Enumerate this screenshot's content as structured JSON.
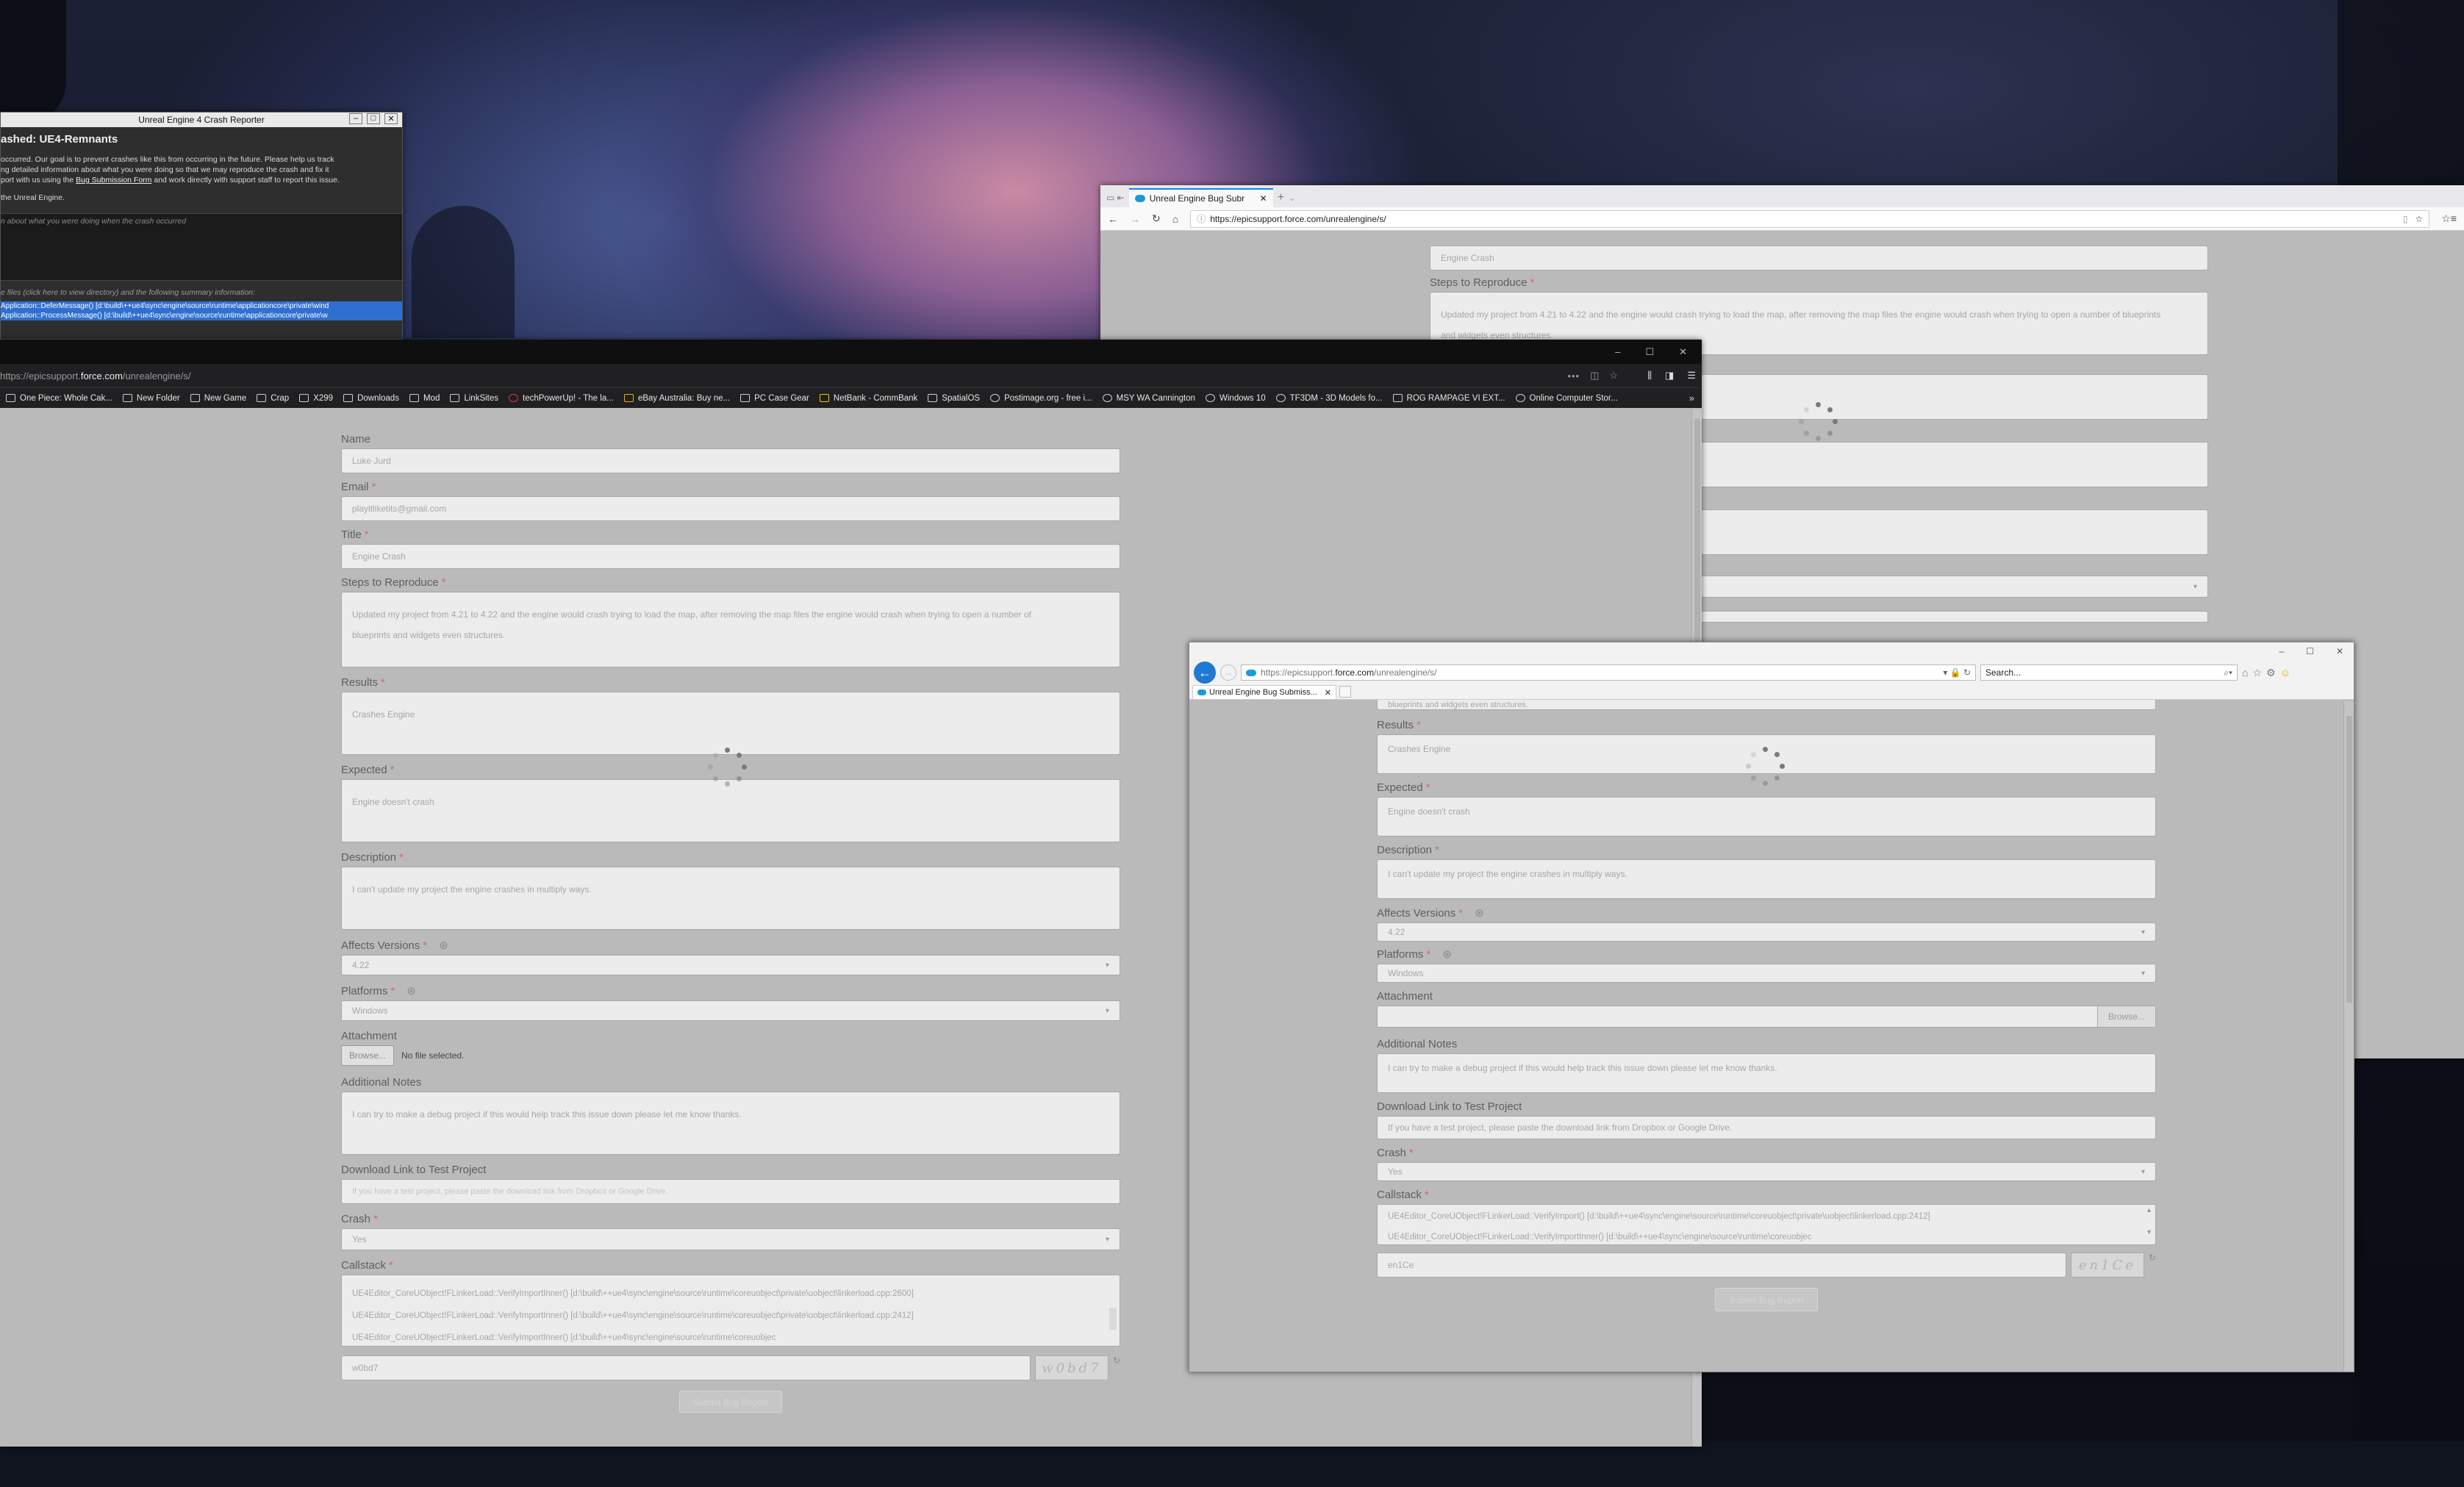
{
  "crash_reporter": {
    "window_title": "Unreal Engine 4 Crash Reporter",
    "heading": "ashed: UE4-Remnants",
    "body_lines": [
      "occurred. Our goal is to prevent crashes like this from occurring in the future. Please help us track",
      "ng detailed information about what you were doing so that we may reproduce the crash and fix it",
      "port with us using the ",
      " and work directly with support staff to report this issue.",
      "the Unreal Engine."
    ],
    "link_text": "Bug Submission Form",
    "comment_placeholder": "n about what you were doing when the crash occurred",
    "files_line": "e files (click here to view directory) and the following summary information:",
    "log_lines": [
      "Application::DeferMessage() [d:\\build\\++ue4\\sync\\engine\\source\\runtime\\applicationcore\\private\\wind",
      "Application::ProcessMessage() [d:\\build\\++ue4\\sync\\engine\\source\\runtime\\applicationcore\\private\\w"
    ]
  },
  "firefox_back": {
    "tab_title": "Unreal Engine Bug Subr",
    "url": "https://epicsupport.force.com/unrealengine/s/",
    "title_value": "Engine Crash",
    "steps_label": "Steps to Reproduce",
    "steps_text": "Updated my project from 4.21 to 4.22 and the engine would crash trying to load the map, after removing the map files the engine would crash when trying to open a number of blueprints",
    "steps_text2": "and widgets even structures."
  },
  "firefox_main": {
    "url_prefix": "https://epicsupport.",
    "url_domain": "force.com",
    "url_suffix": "/unrealengine/s/",
    "bookmarks": [
      "One Piece: Whole Cak...",
      "New Folder",
      "New Game",
      "Crap",
      "X299",
      "Downloads",
      "Mod",
      "LinkSites",
      "techPowerUp! - The la...",
      "eBay Australia: Buy ne...",
      "PC Case Gear",
      "NetBank - CommBank",
      "SpatialOS",
      "Postimage.org - free i...",
      "MSY WA Cannington",
      "Windows 10",
      "TF3DM - 3D Models fo...",
      "ROG RAMPAGE VI EXT...",
      "Online Computer Stor..."
    ],
    "form": {
      "name_label": "Name",
      "name_value": "Luke Jurd",
      "email_label": "Email",
      "email_value": "playitliketits@gmail.com",
      "title_label": "Title",
      "title_value": "Engine Crash",
      "steps_label": "Steps to Reproduce",
      "steps_line1": "Updated my project from 4.21 to 4.22 and the engine would crash trying to load the map, after removing the map files the engine would crash when trying to open a number of",
      "steps_line2": "blueprints and widgets even structures.",
      "results_label": "Results",
      "results_value": "Crashes Engine",
      "expected_label": "Expected",
      "expected_value": "Engine doesn't crash",
      "description_label": "Description",
      "description_value": "I can't update my project the engine crashes in multiply ways.",
      "affects_label": "Affects Versions",
      "affects_value": "4.22",
      "platforms_label": "Platforms",
      "platforms_value": "Windows",
      "attachment_label": "Attachment",
      "browse_label": "Browse...",
      "no_file": "No file selected.",
      "notes_label": "Additional Notes",
      "notes_value": "I can try to make a debug project if this would help track this issue down please let me know thanks.",
      "download_label": "Download Link to Test Project",
      "download_placeholder": "If you have a test project, please paste the download link from Dropbox or Google Drive.",
      "crash_label": "Crash",
      "crash_value": "Yes",
      "callstack_label": "Callstack",
      "callstack_lines": [
        "UE4Editor_CoreUObject!FLinkerLoad::VerifyImportInner() [d:\\build\\++ue4\\sync\\engine\\source\\runtime\\coreuobject\\private\\uobject\\linkerload.cpp:2600]",
        "UE4Editor_CoreUObject!FLinkerLoad::VerifyImportInner() [d:\\build\\++ue4\\sync\\engine\\source\\runtime\\coreuobject\\private\\uobject\\linkerload.cpp:2412]",
        "UE4Editor_CoreUObject!FLinkerLoad::VerifyImportInner() [d:\\build\\++ue4\\sync\\engine\\source\\runtime\\coreuobjec"
      ],
      "captcha_input": "w0bd7",
      "captcha_image": "w0bd7",
      "submit_label": "Submit Bug Report"
    }
  },
  "ie": {
    "url_prefix": "https://epicsupport.",
    "url_domain": "force.com",
    "url_suffix": "/unrealengine/s/",
    "search_placeholder": "Search...",
    "tab_title": "Unreal Engine Bug Submiss...",
    "form": {
      "top_text": "blueprints and widgets even structures.",
      "results_label": "Results",
      "results_value": "Crashes Engine",
      "expected_label": "Expected",
      "expected_value": "Engine doesn't crash",
      "description_label": "Description",
      "description_value": "I can't update my project the engine crashes in multiply ways.",
      "affects_label": "Affects Versions",
      "affects_value": "4.22",
      "platforms_label": "Platforms",
      "platforms_value": "Windows",
      "attachment_label": "Attachment",
      "browse_label": "Browse...",
      "notes_label": "Additional Notes",
      "notes_value": "I can try to make a debug project if this would help track this issue down please let me know thanks.",
      "download_label": "Download Link to Test Project",
      "download_placeholder": "If you have a test project, please paste the download link from Dropbox or Google Drive.",
      "crash_label": "Crash",
      "crash_value": "Yes",
      "callstack_label": "Callstack",
      "callstack_lines": [
        "UE4Editor_CoreUObject!FLinkerLoad::VerifyImport() [d:\\build\\++ue4\\sync\\engine\\source\\runtime\\coreuobject\\private\\uobject\\linkerload.cpp:2412]",
        "UE4Editor_CoreUObject!FLinkerLoad::VerifyImportInner() [d:\\build\\++ue4\\sync\\engine\\source\\runtime\\coreuobjec"
      ],
      "captcha_input": "en1Ce",
      "captcha_image": "en1Ce",
      "submit_label": "Submit Bug Report"
    }
  },
  "colors": {
    "form_bg": "#bababa",
    "field_bg": "#ececec",
    "required": "#c8706a",
    "ff_chrome": "#202022",
    "ie_back": "#1f78d1"
  }
}
